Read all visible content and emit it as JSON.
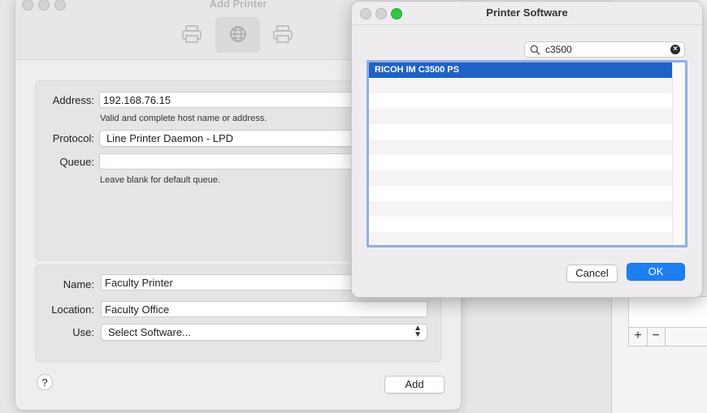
{
  "add_printer": {
    "title": "Add Printer",
    "address": {
      "label": "Address:",
      "value": "192.168.76.15",
      "hint": "Valid and complete host name or address."
    },
    "protocol": {
      "label": "Protocol:",
      "value": "Line Printer Daemon - LPD"
    },
    "queue": {
      "label": "Queue:",
      "value": "",
      "hint": "Leave blank for default queue."
    },
    "name": {
      "label": "Name:",
      "value": "Faculty Printer"
    },
    "location": {
      "label": "Location:",
      "value": "Faculty Office"
    },
    "use": {
      "label": "Use:",
      "value": "Select Software..."
    },
    "help_label": "?",
    "add_label": "Add"
  },
  "printer_software": {
    "title": "Printer Software",
    "search_value": "c3500",
    "results": [
      "RICOH IM C3500 PS"
    ],
    "cancel_label": "Cancel",
    "ok_label": "OK"
  },
  "background_window": {
    "plus_label": "+",
    "minus_label": "−"
  },
  "colors": {
    "selection": "#1f61c4",
    "ok_button": "#1e7ff3",
    "list_focus": "#90aee6"
  }
}
